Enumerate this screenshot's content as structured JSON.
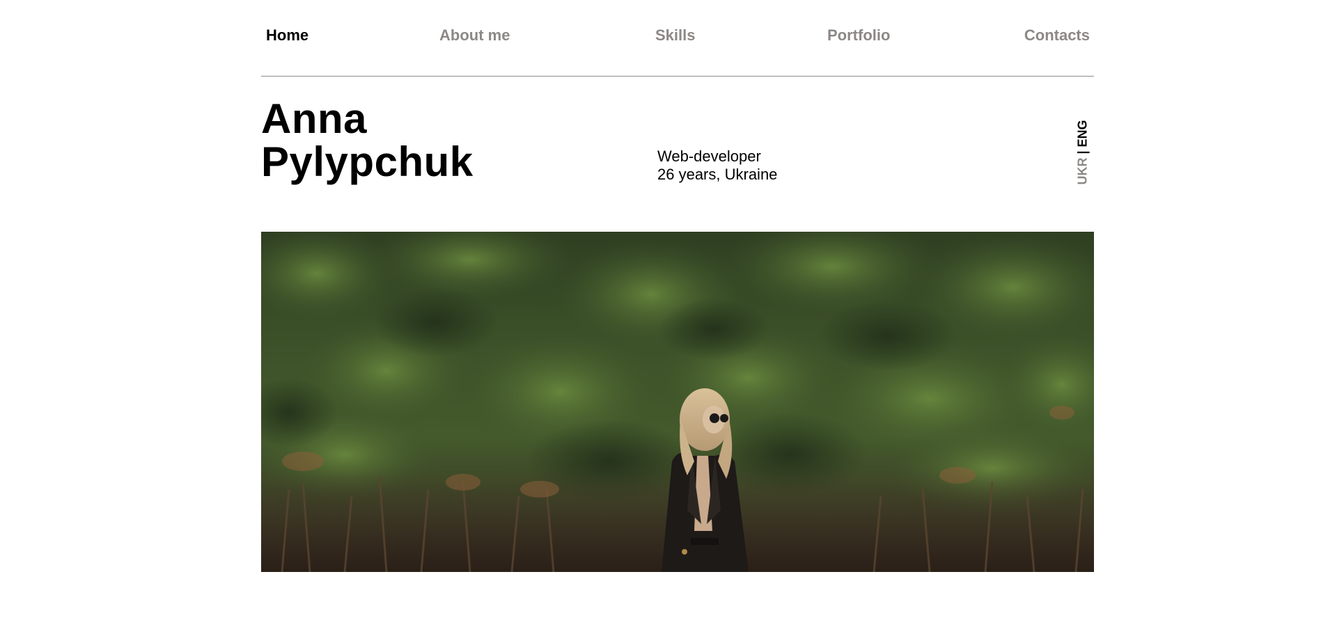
{
  "nav": {
    "items": [
      {
        "label": "Home",
        "active": true
      },
      {
        "label": "About me",
        "active": false
      },
      {
        "label": "Skills",
        "active": false
      },
      {
        "label": "Portfolio",
        "active": false
      },
      {
        "label": "Contacts",
        "active": false
      }
    ]
  },
  "hero": {
    "name_line1": "Anna",
    "name_line2": "Pylypchuk",
    "role": "Web-developer",
    "age_location": "26 years, Ukraine"
  },
  "language": {
    "options": [
      "UKR",
      "ENG"
    ],
    "separator": "|",
    "active": "ENG"
  },
  "photo": {
    "subject": "person-in-front-of-hedge"
  },
  "colors": {
    "text": "#000000",
    "muted": "#8c8886",
    "divider": "#8a8a8a",
    "background": "#ffffff"
  }
}
